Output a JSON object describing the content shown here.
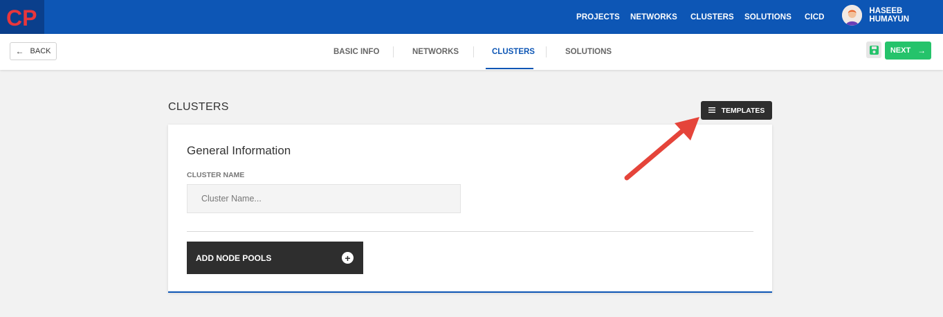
{
  "topbar": {
    "logo_text": "CP",
    "nav": [
      "PROJECTS",
      "NETWORKS",
      "CLUSTERS",
      "SOLUTIONS",
      "CICD"
    ],
    "user_name": "HASEEB HUMAYUN"
  },
  "subbar": {
    "back_label": "BACK",
    "tabs": [
      "BASIC INFO",
      "NETWORKS",
      "CLUSTERS",
      "SOLUTIONS"
    ],
    "active_tab": "CLUSTERS",
    "next_label": "NEXT"
  },
  "content": {
    "page_title": "CLUSTERS",
    "templates_label": "TEMPLATES",
    "section_title": "General Information",
    "cluster_name_label": "CLUSTER NAME",
    "cluster_name_placeholder": "Cluster Name...",
    "cluster_name_value": "",
    "add_node_pools_label": "ADD NODE POOLS"
  },
  "colors": {
    "primary": "#0d56b5",
    "success": "#25c36b",
    "dark_button": "#2e2e2e",
    "annotation_arrow": "#e5443a"
  },
  "icons": [
    "back-arrow-icon",
    "save-icon",
    "next-arrow-icon",
    "hamburger-icon",
    "plus-circle-icon",
    "avatar-icon"
  ]
}
